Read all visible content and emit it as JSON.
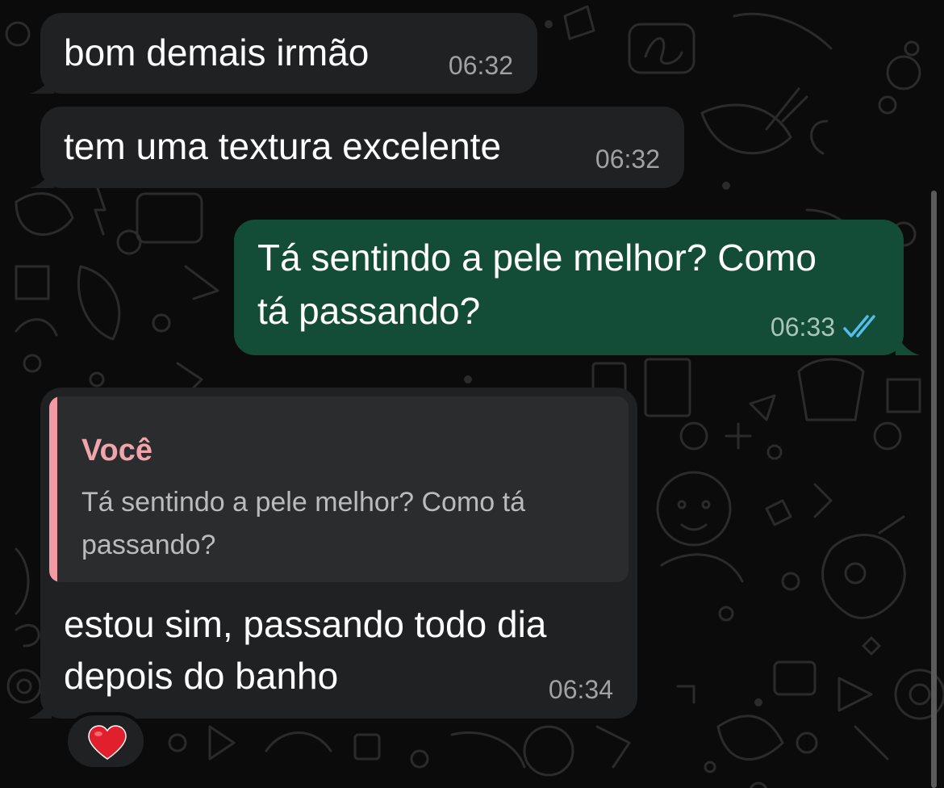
{
  "chat": {
    "messages": [
      {
        "direction": "incoming",
        "text": "bom demais irmão",
        "time": "06:32"
      },
      {
        "direction": "incoming",
        "text": "tem uma textura excelente",
        "time": "06:32"
      },
      {
        "direction": "outgoing",
        "text_lines": [
          "Tá sentindo a pele melhor? Como",
          "tá passando?"
        ],
        "time": "06:33",
        "status": "read",
        "status_icon": "double-check-icon"
      },
      {
        "direction": "incoming",
        "quote": {
          "author": "Você",
          "text_lines": [
            "Tá sentindo a pele melhor? Como tá",
            "passando?"
          ]
        },
        "text_lines": [
          "estou sim, passando todo dia",
          "depois do banho"
        ],
        "time": "06:34",
        "reaction": "❤️"
      }
    ]
  },
  "colors": {
    "background": "#0b0b0b",
    "incoming_bubble": "#1f2123",
    "outgoing_bubble": "#134d37",
    "quote_accent": "#f19aa3",
    "read_ticks": "#53bdeb",
    "heart": "#e0202d"
  }
}
